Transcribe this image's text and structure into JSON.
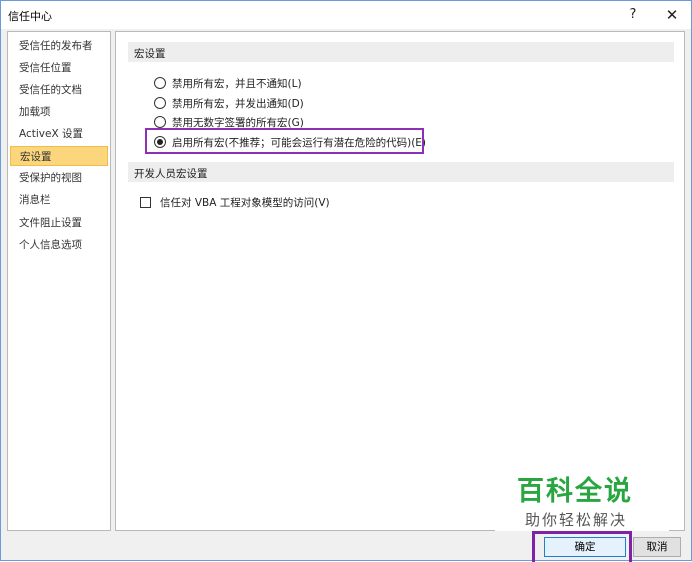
{
  "window": {
    "title": "信任中心",
    "help_glyph": "?",
    "close_glyph": "✕"
  },
  "sidebar": {
    "items": [
      {
        "label": "受信任的发布者"
      },
      {
        "label": "受信任位置"
      },
      {
        "label": "受信任的文档"
      },
      {
        "label": "加载项"
      },
      {
        "label": "ActiveX 设置"
      },
      {
        "label": "宏设置",
        "selected": true
      },
      {
        "label": "受保护的视图"
      },
      {
        "label": "消息栏"
      },
      {
        "label": "文件阻止设置"
      },
      {
        "label": "个人信息选项"
      }
    ]
  },
  "macro_settings": {
    "header": "宏设置",
    "options": [
      {
        "label": "禁用所有宏，并且不通知(L)",
        "selected": false
      },
      {
        "label": "禁用所有宏，并发出通知(D)",
        "selected": false
      },
      {
        "label": "禁用无数字签署的所有宏(G)",
        "selected": false
      },
      {
        "label": "启用所有宏(不推荐；可能会运行有潜在危险的代码)(E)",
        "selected": true
      }
    ]
  },
  "developer_settings": {
    "header": "开发人员宏设置",
    "vba_access_label": "信任对 VBA 工程对象模型的访问(V)",
    "vba_access_checked": false
  },
  "watermark": {
    "main": "百科全说",
    "sub": "助你轻松解决"
  },
  "buttons": {
    "ok": "确定",
    "cancel": "取消"
  },
  "colors": {
    "selected_nav": "#fbd67c",
    "highlight_box": "#8e2fb5",
    "watermark_green": "#2aa641",
    "ok_border": "#1e7fd0"
  }
}
